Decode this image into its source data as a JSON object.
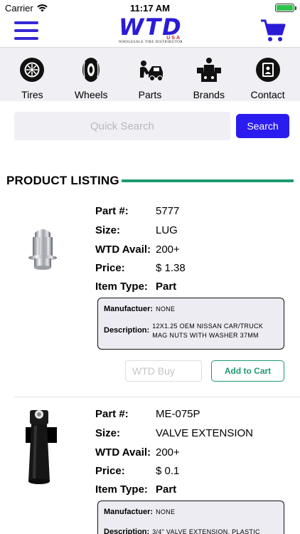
{
  "status_bar": {
    "carrier": "Carrier",
    "time": "11:17 AM"
  },
  "header": {
    "logo_text": "WTD",
    "logo_usa": "USA",
    "logo_tagline": "WHOLESALE TIRE DISTRIBUTOR"
  },
  "categories": [
    {
      "label": "Tires",
      "icon": "tire-icon"
    },
    {
      "label": "Wheels",
      "icon": "wheel-icon"
    },
    {
      "label": "Parts",
      "icon": "mechanic-icon"
    },
    {
      "label": "Brands",
      "icon": "brands-icon"
    },
    {
      "label": "Contact",
      "icon": "contact-icon"
    }
  ],
  "search": {
    "placeholder": "Quick Search",
    "button_label": "Search"
  },
  "section_title": "PRODUCT LISTING",
  "field_labels": {
    "part": "Part #:",
    "size": "Size:",
    "avail": "WTD Avail:",
    "price": "Price:",
    "item_type": "Item Type:",
    "manufacturer": "Manufactuer:",
    "description": "Description:"
  },
  "products": [
    {
      "part": "5777",
      "size": "LUG",
      "avail": "200+",
      "price": "$ 1.38",
      "item_type": "Part",
      "manufacturer": "NONE",
      "description": "12X1.25 OEM NISSAN CAR/TRUCK MAG NUTS WITH WASHER 37MM",
      "buy_placeholder": "WTD Buy",
      "add_label": "Add to Cart"
    },
    {
      "part": "ME-075P",
      "size": "VALVE EXTENSION",
      "avail": "200+",
      "price": "$ 0.1",
      "item_type": "Part",
      "manufacturer": "NONE",
      "description": "3/4\" VALVE EXTENSION, PLASTIC"
    }
  ],
  "colors": {
    "brand_blue": "#2a1bef",
    "accent_green": "#1f9a6e",
    "nav_bg": "#efeff4"
  }
}
